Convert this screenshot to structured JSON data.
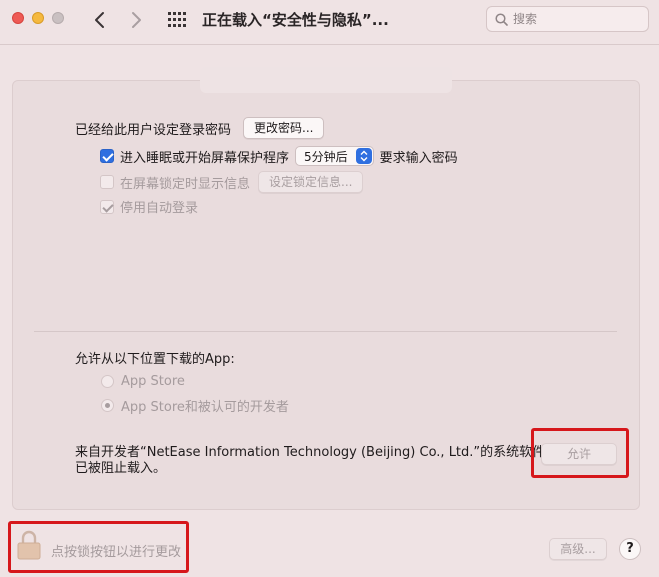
{
  "window": {
    "title": "正在载入“安全性与隐私”..."
  },
  "search": {
    "placeholder": "搜索"
  },
  "login": {
    "label": "已经给此用户设定登录密码",
    "change_button": "更改密码..."
  },
  "sleep": {
    "checkbox_label": "进入睡眠或开始屏幕保护程序",
    "checked": true,
    "select_value": "5分钟后",
    "suffix": "要求输入密码"
  },
  "lock_message": {
    "checkbox_label": "在屏幕锁定时显示信息",
    "button": "设定锁定信息..."
  },
  "auto_login": {
    "checkbox_label": "停用自动登录",
    "checked": true
  },
  "download": {
    "heading": "允许从以下位置下载的App:",
    "options": [
      "App Store",
      "App Store和被认可的开发者"
    ],
    "selected_index": 1
  },
  "blocked": {
    "line1": "来自开发者“NetEase Information Technology (Beijing) Co., Ltd.”的系统软件",
    "line2": "已被阻止载入。",
    "allow_button": "允许"
  },
  "footer": {
    "lock_text": "点按锁按钮以进行更改",
    "advanced_button": "高级...",
    "help_button": "?"
  },
  "colors": {
    "accent": "#2f6fe0",
    "highlight": "#d6171b"
  }
}
